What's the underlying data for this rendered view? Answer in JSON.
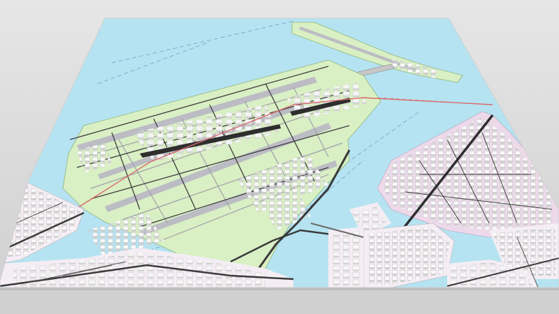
{
  "scene": {
    "kind": "3d-map-render",
    "feature_types": [
      "water",
      "airport-land",
      "runways",
      "terminals",
      "urban-blocks",
      "roads",
      "bridges",
      "rail"
    ]
  },
  "colors": {
    "background": "#e3e3e3",
    "water": "#b5e3f1",
    "airport_land": "#d9efc4",
    "urban_land": "#f4eef4",
    "urban_land_pink": "#ecd9ea",
    "runway": "#bcbcc4",
    "taxiway": "#c9c9cf",
    "building": "#f5f5f5",
    "building_shade": "#c8c8c8",
    "road_major": "#444444",
    "road_minor": "#555555",
    "rail": "#d96b6b",
    "ferry_line": "#5a7fb5"
  }
}
